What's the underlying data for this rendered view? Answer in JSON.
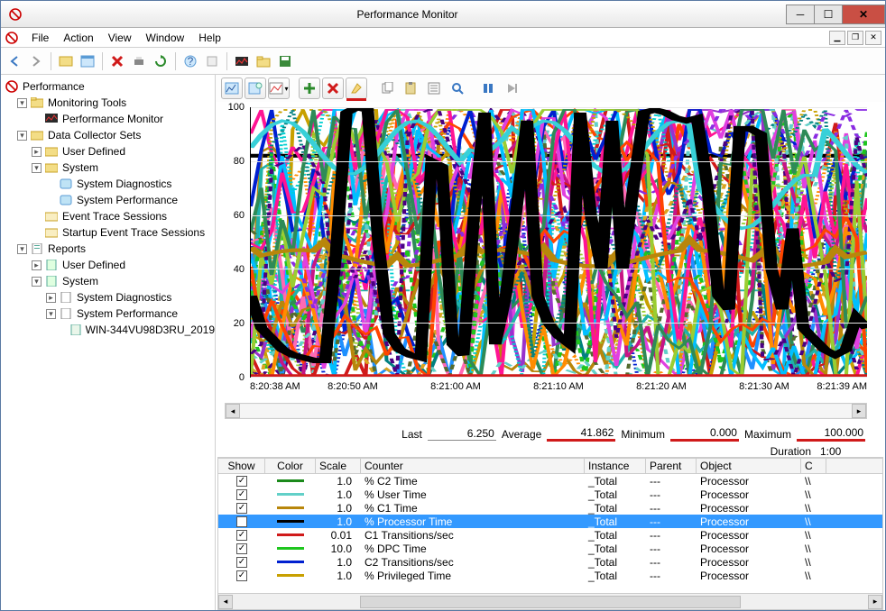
{
  "window": {
    "title": "Performance Monitor"
  },
  "menu": {
    "items": [
      "File",
      "Action",
      "View",
      "Window",
      "Help"
    ]
  },
  "tree": {
    "root": "Performance",
    "monitoring_tools": "Monitoring Tools",
    "perfmon": "Performance Monitor",
    "dcs": "Data Collector Sets",
    "user_defined": "User Defined",
    "system": "System",
    "sys_diag": "System Diagnostics",
    "sys_perf": "System Performance",
    "ets": "Event Trace Sessions",
    "sets": "Startup Event Trace Sessions",
    "reports": "Reports",
    "r_user_defined": "User Defined",
    "r_system": "System",
    "r_sys_diag": "System Diagnostics",
    "r_sys_perf": "System Performance",
    "r_report": "WIN-344VU98D3RU_2019"
  },
  "chart_data": {
    "type": "line",
    "ylim": [
      0,
      100
    ],
    "y_ticks": [
      0,
      20,
      40,
      60,
      80,
      100
    ],
    "x_ticks": [
      "8:20:38 AM",
      "8:20:50 AM",
      "8:21:00 AM",
      "8:21:10 AM",
      "8:21:20 AM",
      "8:21:30 AM",
      "8:21:39 AM"
    ],
    "highlight_series": {
      "name": "% Processor Time",
      "color": "#000000",
      "values": [
        30,
        18,
        14,
        10,
        8,
        7,
        6,
        6,
        45,
        98,
        100,
        99,
        50,
        16,
        10,
        8,
        7,
        80,
        78,
        12,
        8,
        60,
        98,
        12,
        30,
        62,
        95,
        30,
        20,
        15,
        12,
        98,
        60,
        40,
        95,
        40,
        70,
        98,
        99,
        98,
        96,
        95,
        96,
        70,
        30,
        25,
        92,
        92,
        90,
        40,
        25,
        55,
        18,
        14,
        10,
        8,
        10,
        22,
        18
      ]
    },
    "background_series_count": 40
  },
  "stats": {
    "last_label": "Last",
    "last": "6.250",
    "avg_label": "Average",
    "avg": "41.862",
    "min_label": "Minimum",
    "min": "0.000",
    "max_label": "Maximum",
    "max": "100.000",
    "duration_label": "Duration",
    "duration": "1:00"
  },
  "grid": {
    "headers": {
      "show": "Show",
      "color": "Color",
      "scale": "Scale",
      "counter": "Counter",
      "instance": "Instance",
      "parent": "Parent",
      "object": "Object",
      "computer": "C"
    },
    "rows": [
      {
        "color": "#1b8a1b",
        "scale": "1.0",
        "counter": "% C2 Time",
        "instance": "_Total",
        "parent": "---",
        "object": "Processor",
        "computer": "\\\\"
      },
      {
        "color": "#62d0c8",
        "scale": "1.0",
        "counter": "% User Time",
        "instance": "_Total",
        "parent": "---",
        "object": "Processor",
        "computer": "\\\\"
      },
      {
        "color": "#b8860b",
        "scale": "1.0",
        "counter": "% C1 Time",
        "instance": "_Total",
        "parent": "---",
        "object": "Processor",
        "computer": "\\\\"
      },
      {
        "color": "#000000",
        "scale": "1.0",
        "counter": "% Processor Time",
        "instance": "_Total",
        "parent": "---",
        "object": "Processor",
        "computer": "\\\\",
        "selected": true
      },
      {
        "color": "#d01a1a",
        "scale": "0.01",
        "counter": "C1 Transitions/sec",
        "instance": "_Total",
        "parent": "---",
        "object": "Processor",
        "computer": "\\\\"
      },
      {
        "color": "#1ec61e",
        "scale": "10.0",
        "counter": "% DPC Time",
        "instance": "_Total",
        "parent": "---",
        "object": "Processor",
        "computer": "\\\\"
      },
      {
        "color": "#0020d0",
        "scale": "1.0",
        "counter": "C2 Transitions/sec",
        "instance": "_Total",
        "parent": "---",
        "object": "Processor",
        "computer": "\\\\"
      },
      {
        "color": "#c8a000",
        "scale": "1.0",
        "counter": "% Privileged Time",
        "instance": "_Total",
        "parent": "---",
        "object": "Processor",
        "computer": "\\\\"
      }
    ]
  },
  "colors": {
    "palette": [
      "#d01a1a",
      "#1ec61e",
      "#0020d0",
      "#c8a000",
      "#b8860b",
      "#62d0c8",
      "#e040e0",
      "#ff8c00",
      "#008080",
      "#8a2be2",
      "#00bfff",
      "#ff1493",
      "#9acd32",
      "#4b0082",
      "#ff4500",
      "#2e8b57",
      "#1e90ff",
      "#daa520",
      "#9932cc",
      "#20b2aa",
      "#ff69b4",
      "#556b2f",
      "#00ced1",
      "#c71585"
    ]
  }
}
